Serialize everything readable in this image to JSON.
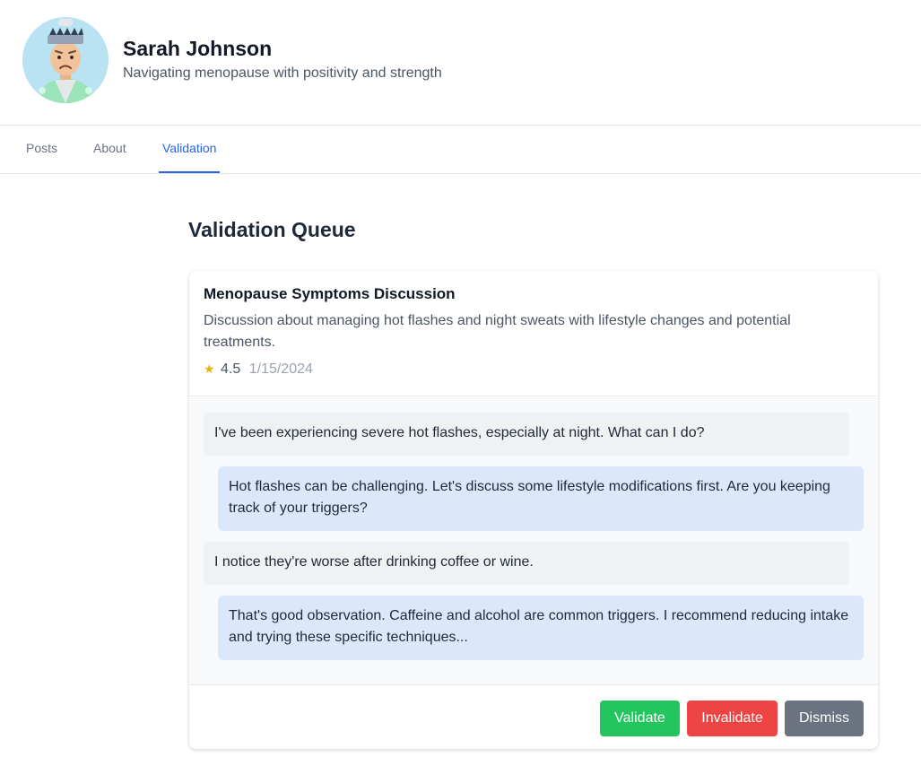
{
  "profile": {
    "name": "Sarah Johnson",
    "bio": "Navigating menopause with positivity and strength"
  },
  "tabs": [
    {
      "label": "Posts"
    },
    {
      "label": "About"
    },
    {
      "label": "Validation",
      "active": true
    }
  ],
  "validation": {
    "heading": "Validation Queue",
    "post": {
      "title": "Menopause Symptoms Discussion",
      "description": "Discussion about managing hot flashes and night sweats with lifestyle changes and potential treatments.",
      "star_icon": "★",
      "rating": "4.5",
      "date": "1/15/2024"
    },
    "messages": [
      {
        "role": "user",
        "text": "I've been experiencing severe hot flashes, especially at night. What can I do?"
      },
      {
        "role": "assistant",
        "text": "Hot flashes can be challenging. Let's discuss some lifestyle modifications first. Are you keeping track of your triggers?"
      },
      {
        "role": "user",
        "text": "I notice they're worse after drinking coffee or wine."
      },
      {
        "role": "assistant",
        "text": "That's good observation. Caffeine and alcohol are common triggers. I recommend reducing intake and trying these specific techniques..."
      }
    ],
    "actions": {
      "validate": "Validate",
      "invalidate": "Invalidate",
      "dismiss": "Dismiss"
    }
  },
  "colors": {
    "accent": "#2563eb",
    "validate": "#22c55e",
    "invalidate": "#ef4444",
    "dismiss": "#6b7280",
    "assistant_bubble": "#dbe8fc",
    "user_bubble": "#f0f1f3",
    "star": "#eab308"
  }
}
